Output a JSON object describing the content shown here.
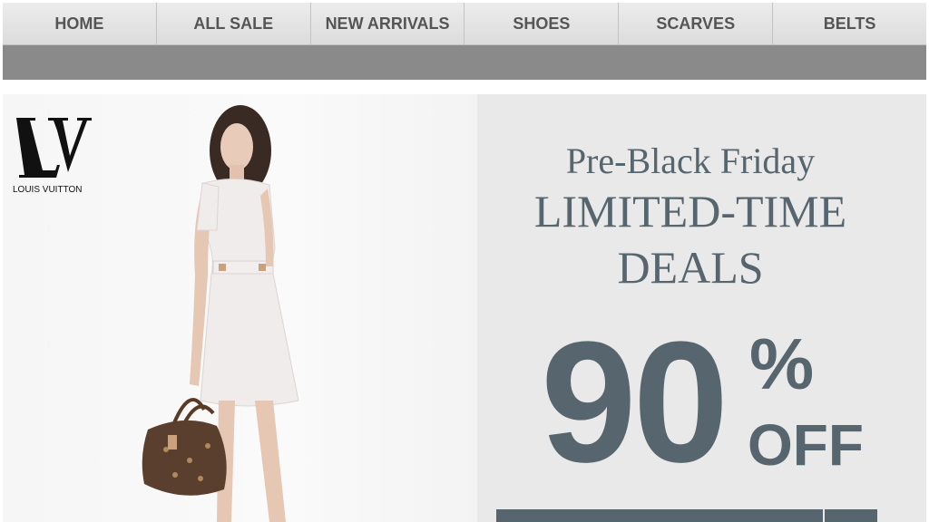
{
  "nav": {
    "items": [
      {
        "label": "HOME"
      },
      {
        "label": "ALL SALE"
      },
      {
        "label": "NEW ARRIVALS"
      },
      {
        "label": "SHOES"
      },
      {
        "label": "SCARVES"
      },
      {
        "label": "BELTS"
      }
    ]
  },
  "brand": {
    "monogram": "LV",
    "name": "LOUIS VUITTON"
  },
  "promo": {
    "line1": "Pre-Black Friday",
    "line2": "LIMITED-TIME",
    "line3": "DEALS",
    "discount_number": "90",
    "percent_sign": "%",
    "off_label": "OFF"
  },
  "colors": {
    "promo_text": "#57666e",
    "nav_bg": "#e2e2e2",
    "subbar": "#8a8a8a"
  }
}
